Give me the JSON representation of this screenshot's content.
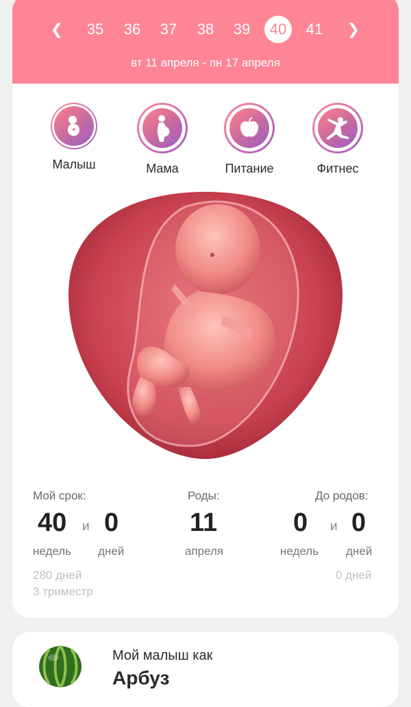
{
  "header": {
    "weeks": [
      "35",
      "36",
      "37",
      "38",
      "39",
      "40",
      "41"
    ],
    "active_week": "40",
    "date_range": "вт 11 апреля - пн 17 апреля",
    "color": "#fd8595"
  },
  "categories": [
    {
      "label": "Малыш",
      "icon": "baby-icon"
    },
    {
      "label": "Мама",
      "icon": "pregnant-woman-icon"
    },
    {
      "label": "Питание",
      "icon": "apple-icon"
    },
    {
      "label": "Фитнес",
      "icon": "fitness-icon"
    }
  ],
  "stats": {
    "term": {
      "label": "Мой срок:",
      "weeks": "40",
      "and": "и",
      "days": "0",
      "weeks_unit": "недель",
      "days_unit": "дней",
      "total_days": "280 дней",
      "trimester": "3 триместр"
    },
    "birth": {
      "label": "Роды:",
      "day": "11",
      "month": "апреля"
    },
    "until": {
      "label": "До родов:",
      "weeks": "0",
      "and": "и",
      "days": "0",
      "weeks_unit": "недель",
      "days_unit": "дней",
      "total_days": "0 дней"
    }
  },
  "fruit": {
    "subtitle": "Мой малыш как",
    "name": "Арбуз",
    "icon": "watermelon-icon"
  }
}
